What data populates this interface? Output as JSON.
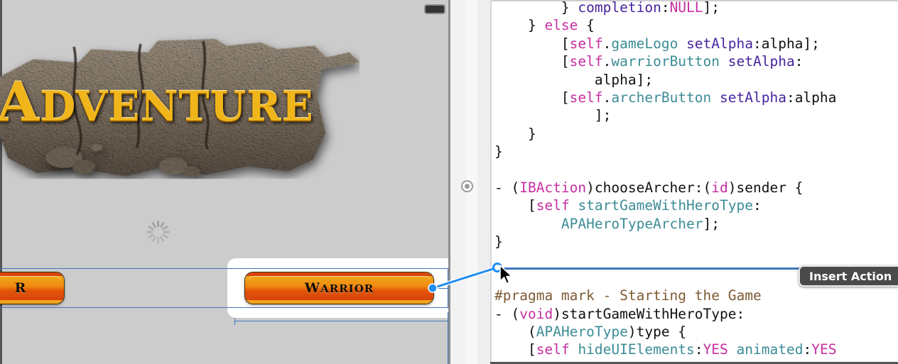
{
  "canvas": {
    "name": "interface-builder-canvas",
    "background_color": "#cccccc",
    "status_indicator": "status-bar-pill",
    "logo": {
      "text_prefix": "A",
      "text_rest": "DVENTURE",
      "full_text": "ADVENTURE",
      "style": "stone-banner-gold-lettering"
    },
    "spinner": "activity-indicator",
    "buttons": [
      {
        "id": "archer-button",
        "label": "R",
        "full_label": "ARCHER",
        "clipped": true
      },
      {
        "id": "warrior-button",
        "label_first": "W",
        "label_rest": "ARRIOR",
        "full_label": "WARRIOR",
        "selected": true
      }
    ]
  },
  "connection": {
    "type": "ctrl-drag-outlet-connection",
    "color": "#1f8df0",
    "from": "warrior-button",
    "to": "code-insertion-point"
  },
  "tooltip": {
    "label": "Insert Action",
    "background": "#4a4a4a",
    "text_color": "#ffffff"
  },
  "gutter": {
    "marker": "method-definition-marker"
  },
  "editor": {
    "language": "objective-c",
    "colors": {
      "self_keyword": "#c72fa0",
      "property": "#3c8c96",
      "message_part": "#47249e",
      "pragma": "#7d5b33",
      "plain": "#111111"
    },
    "lines": [
      {
        "indent": 8,
        "tokens": [
          {
            "t": "} ",
            "c": "plain"
          },
          {
            "t": "completion",
            "c": "msg"
          },
          {
            "t": ":",
            "c": "plain"
          },
          {
            "t": "NULL",
            "c": "type"
          },
          {
            "t": "];",
            "c": "plain"
          }
        ]
      },
      {
        "indent": 4,
        "tokens": [
          {
            "t": "} ",
            "c": "plain"
          },
          {
            "t": "else",
            "c": "type"
          },
          {
            "t": " {",
            "c": "plain"
          }
        ]
      },
      {
        "indent": 8,
        "tokens": [
          {
            "t": "[",
            "c": "plain"
          },
          {
            "t": "self",
            "c": "self"
          },
          {
            "t": ".",
            "c": "plain"
          },
          {
            "t": "gameLogo",
            "c": "prop"
          },
          {
            "t": " ",
            "c": "plain"
          },
          {
            "t": "setAlpha",
            "c": "msg"
          },
          {
            "t": ":alpha];",
            "c": "plain"
          }
        ]
      },
      {
        "indent": 8,
        "tokens": [
          {
            "t": "[",
            "c": "plain"
          },
          {
            "t": "self",
            "c": "self"
          },
          {
            "t": ".",
            "c": "plain"
          },
          {
            "t": "warriorButton",
            "c": "prop"
          },
          {
            "t": " ",
            "c": "plain"
          },
          {
            "t": "setAlpha",
            "c": "msg"
          },
          {
            "t": ":",
            "c": "plain"
          }
        ]
      },
      {
        "indent": 12,
        "tokens": [
          {
            "t": "alpha];",
            "c": "plain"
          }
        ]
      },
      {
        "indent": 8,
        "tokens": [
          {
            "t": "[",
            "c": "plain"
          },
          {
            "t": "self",
            "c": "self"
          },
          {
            "t": ".",
            "c": "plain"
          },
          {
            "t": "archerButton",
            "c": "prop"
          },
          {
            "t": " ",
            "c": "plain"
          },
          {
            "t": "setAlpha",
            "c": "msg"
          },
          {
            "t": ":alpha",
            "c": "plain"
          }
        ]
      },
      {
        "indent": 12,
        "tokens": [
          {
            "t": "];",
            "c": "plain"
          }
        ]
      },
      {
        "indent": 4,
        "tokens": [
          {
            "t": "}",
            "c": "plain"
          }
        ]
      },
      {
        "indent": 0,
        "tokens": [
          {
            "t": "}",
            "c": "plain"
          }
        ]
      },
      {
        "indent": 0,
        "tokens": [
          {
            "t": "",
            "c": "plain"
          }
        ]
      },
      {
        "indent": 0,
        "tokens": [
          {
            "t": "- (",
            "c": "plain"
          },
          {
            "t": "IBAction",
            "c": "type"
          },
          {
            "t": ")chooseArcher:(",
            "c": "plain"
          },
          {
            "t": "id",
            "c": "type"
          },
          {
            "t": ")sender {",
            "c": "plain"
          }
        ]
      },
      {
        "indent": 4,
        "tokens": [
          {
            "t": "[",
            "c": "plain"
          },
          {
            "t": "self",
            "c": "self"
          },
          {
            "t": " ",
            "c": "plain"
          },
          {
            "t": "startGameWithHeroType",
            "c": "prop"
          },
          {
            "t": ":",
            "c": "plain"
          }
        ]
      },
      {
        "indent": 8,
        "tokens": [
          {
            "t": "APAHeroTypeArcher",
            "c": "prop"
          },
          {
            "t": "];",
            "c": "plain"
          }
        ]
      },
      {
        "indent": 0,
        "tokens": [
          {
            "t": "}",
            "c": "plain"
          }
        ]
      },
      {
        "indent": 0,
        "tokens": [
          {
            "t": "",
            "c": "plain"
          }
        ]
      },
      {
        "indent": 0,
        "tokens": [
          {
            "t": "",
            "c": "plain"
          }
        ]
      },
      {
        "indent": 0,
        "tokens": [
          {
            "t": "#pragma mark - Starting the Game",
            "c": "pragma"
          }
        ]
      },
      {
        "indent": 0,
        "tokens": [
          {
            "t": "- (",
            "c": "plain"
          },
          {
            "t": "void",
            "c": "type"
          },
          {
            "t": ")startGameWithHeroType:",
            "c": "plain"
          }
        ]
      },
      {
        "indent": 4,
        "tokens": [
          {
            "t": "(",
            "c": "plain"
          },
          {
            "t": "APAHeroType",
            "c": "prop"
          },
          {
            "t": ")type {",
            "c": "plain"
          }
        ]
      },
      {
        "indent": 4,
        "tokens": [
          {
            "t": "[",
            "c": "plain"
          },
          {
            "t": "self",
            "c": "self"
          },
          {
            "t": " ",
            "c": "plain"
          },
          {
            "t": "hideUIElements",
            "c": "prop"
          },
          {
            "t": ":",
            "c": "plain"
          },
          {
            "t": "YES",
            "c": "type"
          },
          {
            "t": " ",
            "c": "plain"
          },
          {
            "t": "animated",
            "c": "prop"
          },
          {
            "t": ":",
            "c": "plain"
          },
          {
            "t": "YES",
            "c": "type"
          }
        ]
      }
    ]
  }
}
